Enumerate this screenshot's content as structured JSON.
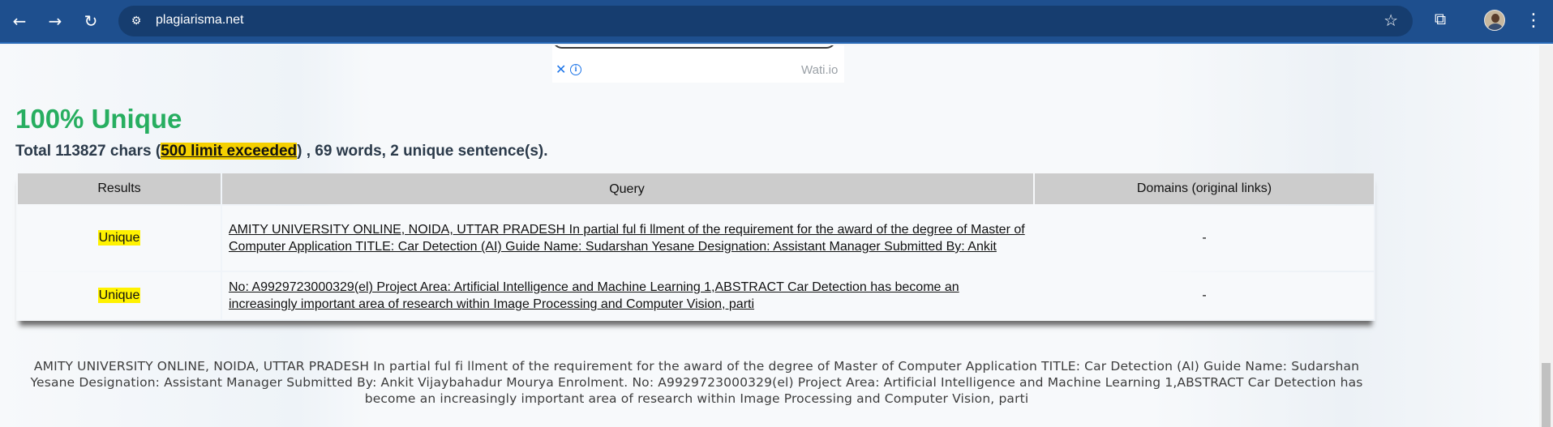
{
  "browser": {
    "url": "plagiarisma.net",
    "icons": {
      "back": "arrow-left-icon",
      "forward": "arrow-right-icon",
      "reload": "reload-icon",
      "site_info": "tune-icon",
      "bookmark": "star-icon",
      "extensions": "puzzle-icon",
      "menu": "kebab-menu-icon"
    }
  },
  "ad": {
    "label": "Wati.io"
  },
  "result": {
    "score": "100% Unique",
    "summary_prefix": "Total 113827 chars (",
    "limit_text": "500 limit exceeded",
    "summary_suffix": ") , 69 words, 2 unique sentence(s).",
    "colors": {
      "score_green": "#27ae60",
      "limit_highlight": "#f5d000",
      "unique_highlight": "#fff200",
      "header_gray": "#cccccc"
    }
  },
  "table": {
    "headers": [
      "Results",
      "Query",
      "Domains (original links)"
    ],
    "rows": [
      {
        "result": "Unique",
        "query": "AMITY UNIVERSITY ONLINE, NOIDA, UTTAR PRADESH In partial ful fi llment of the requirement for the award of the degree of Master of Computer Application TITLE: Car Detection (AI) Guide Name: Sudarshan Yesane Designation: Assistant Manager Submitted By: Ankit",
        "domain": "-"
      },
      {
        "result": "Unique",
        "query": "No: A9929723000329(el) Project Area: Artificial Intelligence and Machine Learning 1,ABSTRACT Car Detection has become an increasingly important area of research within Image Processing and Computer Vision, parti",
        "domain": "-"
      }
    ]
  },
  "full_text": "AMITY UNIVERSITY ONLINE, NOIDA, UTTAR PRADESH In partial ful fi llment of the requirement for the award of the degree of Master of Computer Application TITLE: Car Detection (AI) Guide Name: Sudarshan Yesane Designation: Assistant Manager Submitted By: Ankit Vijaybahadur Mourya Enrolment. No: A9929723000329(el) Project Area: Artificial Intelligence and Machine Learning 1,ABSTRACT Car Detection has become an increasingly important area of research within Image Processing and Computer Vision, parti"
}
